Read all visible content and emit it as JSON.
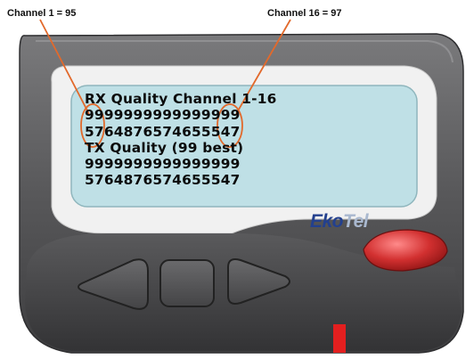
{
  "callouts": {
    "channel_1": "Channel 1 = 95",
    "channel_16": "Channel 16 = 97"
  },
  "screen": {
    "lines": [
      "RX Quality Channel 1-16",
      "9999999999999999",
      "5764876574655547",
      "TX Quality (99 best)",
      "9999999999999999",
      "5764876574655547"
    ]
  },
  "brand": {
    "part1": "Eko",
    "part2": "Tel"
  },
  "colors": {
    "body": "#5c5c5e",
    "bezel": "#f0f0f0",
    "lcd": "#bfe0e6",
    "callout_line": "#e2692b",
    "red_button": "#d23030"
  },
  "icons": [
    "left-arrow-button",
    "menu-button",
    "right-arrow-button",
    "red-button",
    "red-led"
  ]
}
